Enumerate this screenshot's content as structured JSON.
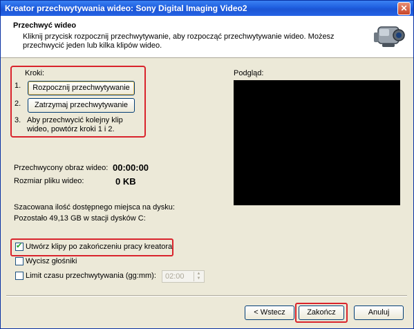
{
  "window": {
    "title": "Kreator przechwytywania wideo: Sony Digital Imaging Video2",
    "close_glyph": "✕"
  },
  "header": {
    "title": "Przechwyć wideo",
    "description": "Kliknij przycisk rozpocznij przechwytywanie, aby rozpocząć przechwytywanie wideo. Możesz przechwycić jeden lub kilka klipów wideo.",
    "icon": "camcorder-icon"
  },
  "steps": {
    "heading": "Kroki:",
    "n1": "1.",
    "start_button": "Rozpocznij przechwytywanie",
    "n2": "2.",
    "stop_button": "Zatrzymaj przechwytywanie",
    "n3": "3.",
    "step3_line1": "Aby przechwycić kolejny klip",
    "step3_line2": "wideo, powtórz kroki 1 i 2."
  },
  "preview": {
    "label": "Podgląd:"
  },
  "capture": {
    "time_label": "Przechwycony obraz wideo:",
    "time_value": "00:00:00",
    "size_label": "Rozmiar pliku wideo:",
    "size_value": "0 KB"
  },
  "disk": {
    "line1": "Szacowana ilość dostępnego miejsca na dysku:",
    "line2": "Pozostało 49,13 GB w stacji dysków C:"
  },
  "options": {
    "create_clips": {
      "label": "Utwórz klipy po zakończeniu pracy kreatora",
      "checked": true
    },
    "mute": {
      "label": "Wycisz głośniki",
      "checked": false
    },
    "limit": {
      "label": "Limit czasu przechwytywania (gg:mm):",
      "checked": false,
      "value": "02:00"
    }
  },
  "buttons": {
    "back": "< Wstecz",
    "finish": "Zakończ",
    "cancel": "Anuluj"
  },
  "colors": {
    "highlight": "#d9232b",
    "title_bar": "#1f5fe0",
    "dialog_bg": "#ece9d8"
  }
}
